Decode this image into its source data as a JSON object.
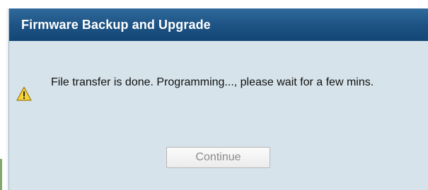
{
  "dialog": {
    "title": "Firmware Backup and Upgrade",
    "message": "File transfer is done. Programming..., please wait for a few mins.",
    "icon": "warning-icon",
    "continue_label": "Continue",
    "colors": {
      "title_bar": "#1c5283",
      "body_background": "#d6e3ea",
      "title_text": "#ffffff",
      "warning_fill": "#f5d33a"
    }
  }
}
